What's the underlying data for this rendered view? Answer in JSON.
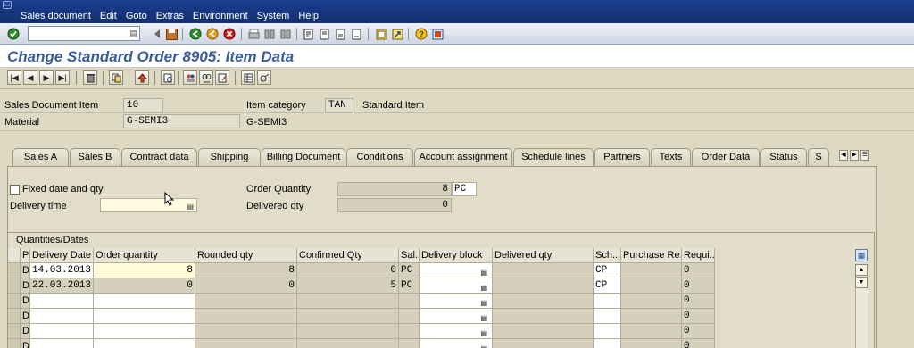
{
  "menu": {
    "items": [
      "Sales document",
      "Edit",
      "Goto",
      "Extras",
      "Environment",
      "System",
      "Help"
    ]
  },
  "toolbar": {
    "command_field": "",
    "icons": [
      "enter-icon",
      "back-icon",
      "save-icon",
      "exit-icon",
      "cancel-icon",
      "print-icon",
      "find-icon",
      "find-next-icon",
      "first-page-icon",
      "prev-page-icon",
      "next-page-icon",
      "last-page-icon",
      "new-session-icon",
      "shortcut-icon",
      "help-icon",
      "layout-icon"
    ]
  },
  "title": "Change Standard Order 8905: Item Data",
  "header": {
    "item_label": "Sales Document Item",
    "item_value": "10",
    "category_label": "Item category",
    "category_value": "TAN",
    "category_text": "Standard Item",
    "material_label": "Material",
    "material_value": "G-SEMI3",
    "material_text": "G-SEMI3"
  },
  "tabs": [
    {
      "label": "Sales A",
      "active": false
    },
    {
      "label": "Sales B",
      "active": false
    },
    {
      "label": "Contract data",
      "active": false
    },
    {
      "label": "Shipping",
      "active": false
    },
    {
      "label": "Billing Document",
      "active": false
    },
    {
      "label": "Conditions",
      "active": false
    },
    {
      "label": "Account assignment",
      "active": false
    },
    {
      "label": "Schedule lines",
      "active": true
    },
    {
      "label": "Partners",
      "active": false
    },
    {
      "label": "Texts",
      "active": false
    },
    {
      "label": "Order Data",
      "active": false
    },
    {
      "label": "Status",
      "active": false
    },
    {
      "label": "S",
      "active": false
    }
  ],
  "schedule": {
    "fixed_label": "Fixed date and qty",
    "fixed_checked": false,
    "delivery_time_label": "Delivery time",
    "delivery_time_value": "",
    "order_qty_label": "Order Quantity",
    "order_qty_value": "8",
    "order_qty_unit": "PC",
    "delivered_qty_label": "Delivered qty",
    "delivered_qty_value": "0"
  },
  "table": {
    "title": "Quantities/Dates",
    "columns": [
      "P",
      "Delivery Date",
      "Order quantity",
      "Rounded qty",
      "Confirmed Qty",
      "Sal...",
      "Delivery block",
      "Delivered qty",
      "Sch...",
      "Purchase Re...",
      "Requi..."
    ],
    "rows": [
      {
        "p": "D",
        "date": "14.03.2013",
        "order_qty": "8",
        "rounded": "8",
        "confirmed": "0",
        "unit": "PC",
        "block": "",
        "delivered": "",
        "sch": "CP",
        "purchase": "",
        "req": "0"
      },
      {
        "p": "D",
        "date": "22.03.2013",
        "order_qty": "0",
        "rounded": "0",
        "confirmed": "5",
        "unit": "PC",
        "block": "",
        "delivered": "",
        "sch": "CP",
        "purchase": "",
        "req": "0"
      },
      {
        "p": "D",
        "date": "",
        "order_qty": "",
        "rounded": "",
        "confirmed": "",
        "unit": "",
        "block": "",
        "delivered": "",
        "sch": "",
        "purchase": "",
        "req": "0"
      },
      {
        "p": "D",
        "date": "",
        "order_qty": "",
        "rounded": "",
        "confirmed": "",
        "unit": "",
        "block": "",
        "delivered": "",
        "sch": "",
        "purchase": "",
        "req": "0"
      },
      {
        "p": "D",
        "date": "",
        "order_qty": "",
        "rounded": "",
        "confirmed": "",
        "unit": "",
        "block": "",
        "delivered": "",
        "sch": "",
        "purchase": "",
        "req": "0"
      },
      {
        "p": "D",
        "date": "",
        "order_qty": "",
        "rounded": "",
        "confirmed": "",
        "unit": "",
        "block": "",
        "delivered": "",
        "sch": "",
        "purchase": "",
        "req": "0"
      }
    ]
  }
}
